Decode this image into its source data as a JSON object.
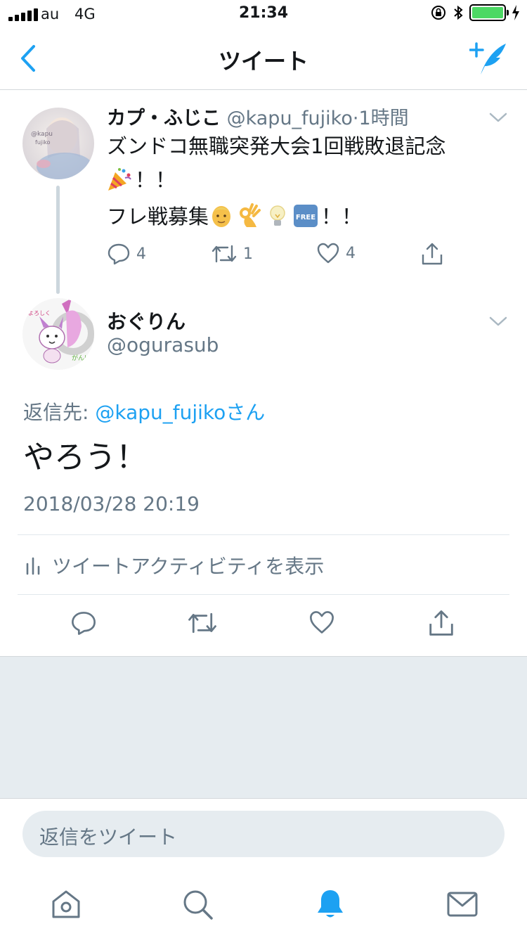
{
  "status_bar": {
    "carrier": "au",
    "network": "4G",
    "time": "21:34"
  },
  "nav": {
    "title": "ツイート",
    "back_icon": "chevron-left-icon",
    "compose_icon": "compose-tweet-icon"
  },
  "tweet1": {
    "name": "カプ・ふじこ",
    "handle": "@kapu_fujiko",
    "separator": "·",
    "time": "1時間",
    "text_line1": "ズンドコ無職突発大会1回戦敗退記念",
    "text_line2": "！！",
    "text_line3_prefix": "フレ戦募集",
    "text_line3_suffix": "！！",
    "reply_count": "4",
    "retweet_count": "1",
    "like_count": "4"
  },
  "tweet2": {
    "name": "おぐりん",
    "handle": "@ogurasub",
    "reply_to_label": "返信先: ",
    "reply_to_mention": "@kapu_fujikoさん",
    "text": "やろう！",
    "date": "2018/03/28 20:19",
    "activity_label": "ツイートアクティビティを表示"
  },
  "reply_input": {
    "placeholder": "返信をツイート"
  },
  "colors": {
    "accent": "#1da1f2",
    "muted": "#657786",
    "background_gray": "#e6ecf0"
  },
  "tabs": [
    "home-icon",
    "search-icon",
    "notifications-icon",
    "messages-icon"
  ]
}
